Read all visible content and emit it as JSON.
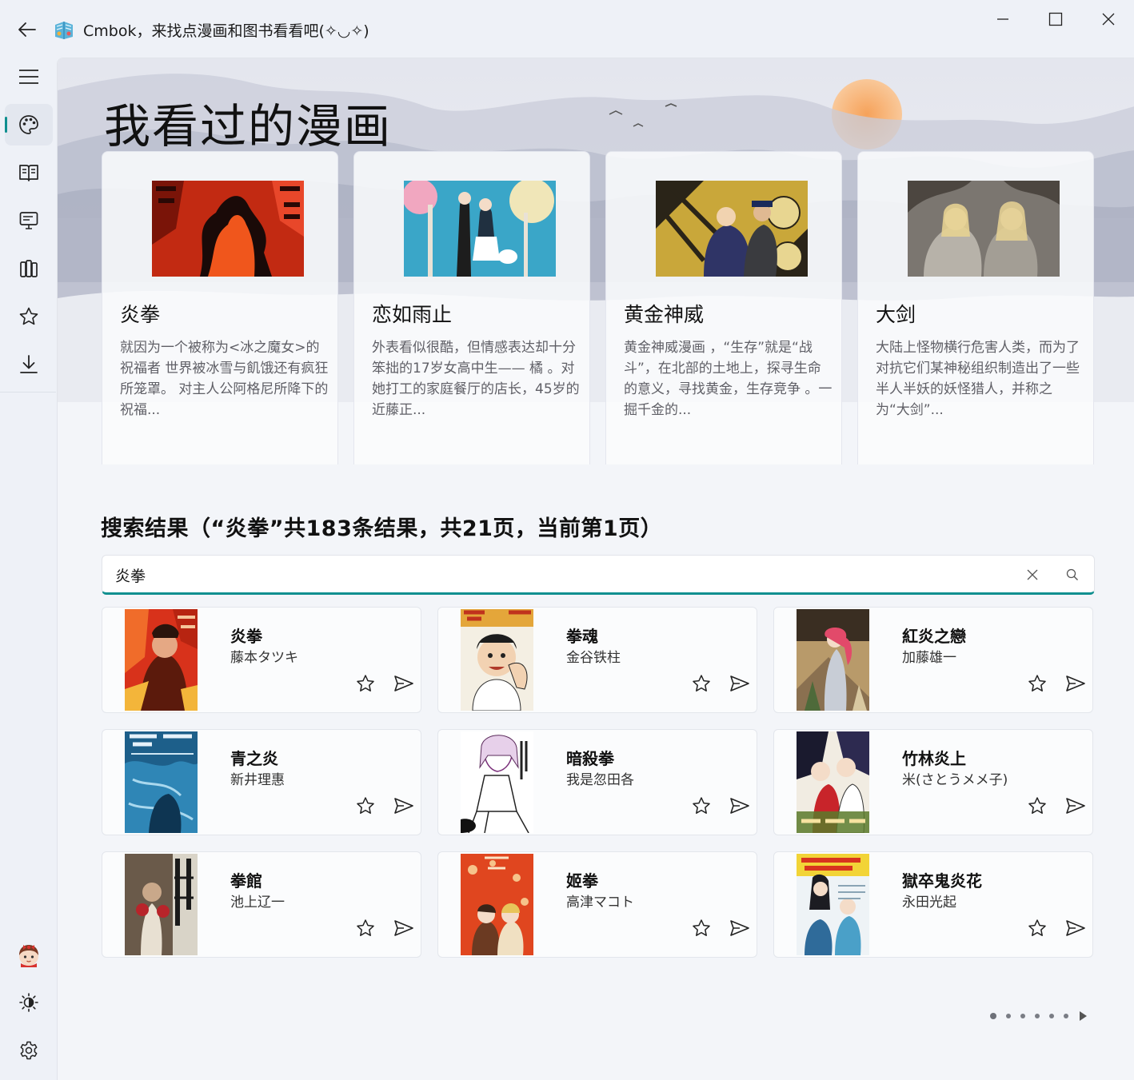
{
  "window": {
    "title": "Cmbok，来找点漫画和图书看看吧(✧◡✧)",
    "back_icon": "back-arrow-icon",
    "minimize_icon": "minimize-icon",
    "maximize_icon": "maximize-icon",
    "close_icon": "close-icon"
  },
  "nav": {
    "top_items": [
      {
        "icon": "hamburger-menu-icon"
      },
      {
        "icon": "palette-icon",
        "active": true
      },
      {
        "icon": "book-open-icon"
      },
      {
        "icon": "presentation-board-icon"
      },
      {
        "icon": "library-books-icon"
      },
      {
        "icon": "star-icon"
      },
      {
        "icon": "download-icon"
      }
    ],
    "bottom_items": [
      {
        "icon": "user-avatar-icon"
      },
      {
        "icon": "theme-brightness-icon"
      },
      {
        "icon": "settings-gear-icon"
      }
    ]
  },
  "hero": {
    "title": "我看过的漫画",
    "cards": [
      {
        "title": "炎拳",
        "description": "就因为一个被称为<冰之魔女>的祝福者 世界被冰雪与飢饿还有疯狂所笼罩。 对主人公阿格尼所降下的祝福..."
      },
      {
        "title": "恋如雨止",
        "description": "外表看似很酷，但情感表达却十分笨拙的17岁女高中生—— 橘 。对她打工的家庭餐厅的店长，45岁的近藤正..."
      },
      {
        "title": "黄金神威",
        "description": "黄金神威漫画 ，“生存”就是“战斗”，在北部的土地上，探寻生命的意义，寻找黄金，生存竞争 。一掘千金的..."
      },
      {
        "title": "大剑",
        "description": "大陆上怪物横行危害人类，而为了对抗它们某神秘组织制造出了一些半人半妖的妖怪猎人，并称之为“大剑”..."
      }
    ]
  },
  "search": {
    "heading": "搜索结果（“炎拳”共183条结果，共21页，当前第1页）",
    "query": "炎拳",
    "clear_icon": "clear-x-icon",
    "search_icon": "search-icon",
    "accent_color": "#0f8f8f"
  },
  "results": [
    {
      "title": "炎拳",
      "author": "藤本タツキ"
    },
    {
      "title": "拳魂",
      "author": "金谷铁柱"
    },
    {
      "title": "紅炎之戀",
      "author": "加藤雄一"
    },
    {
      "title": "青之炎",
      "author": "新井理惠"
    },
    {
      "title": "暗殺拳",
      "author": "我是忽田各"
    },
    {
      "title": "竹林炎上",
      "author": "米(さとうメメ子)"
    },
    {
      "title": "拳館",
      "author": "池上辽一"
    },
    {
      "title": "姬拳",
      "author": "高津マコト"
    },
    {
      "title": "獄卒鬼炎花",
      "author": "永田光起"
    }
  ],
  "result_actions": {
    "favorite_icon": "star-outline-icon",
    "share_icon": "send-icon"
  },
  "pager": {
    "dots": 6,
    "next_icon": "next-page-triangle-icon"
  }
}
